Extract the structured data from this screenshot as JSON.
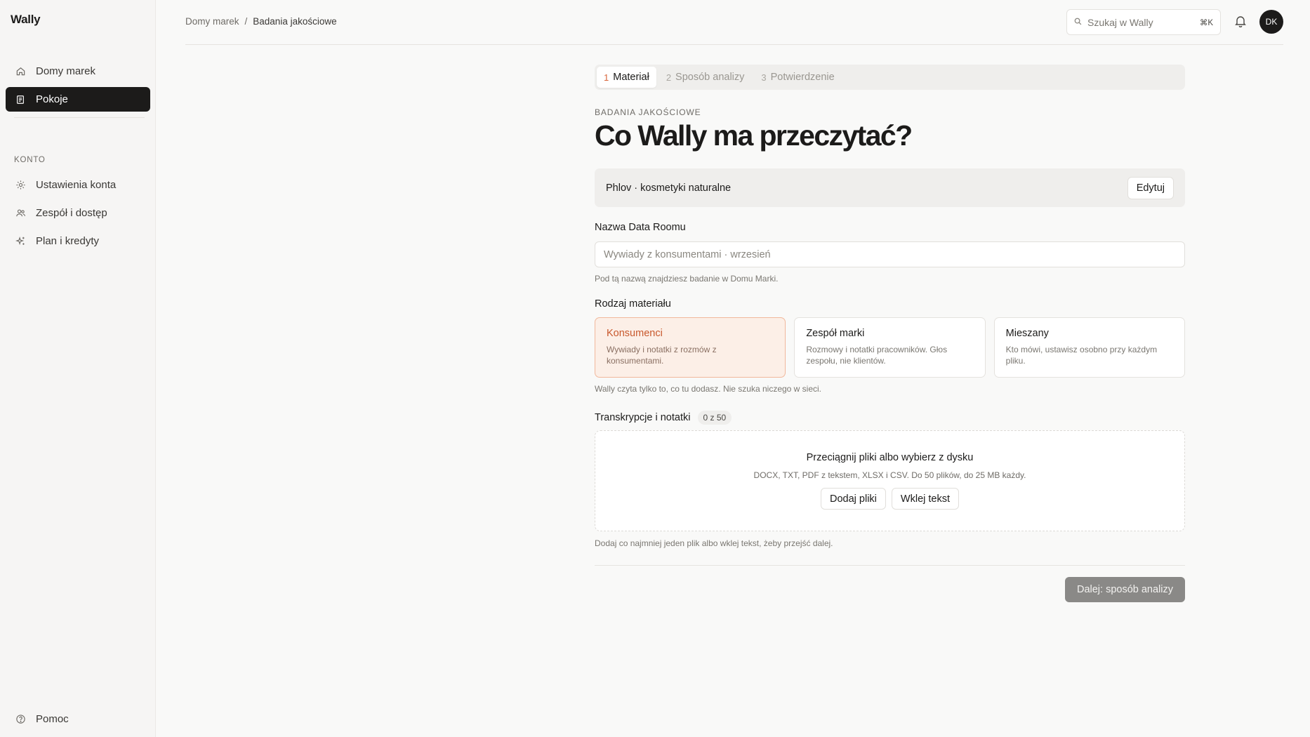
{
  "app": {
    "name": "Wally"
  },
  "sidebar": {
    "items": [
      {
        "label": "Domy marek",
        "icon": "home-icon"
      },
      {
        "label": "Pokoje",
        "icon": "document-icon",
        "active": true
      }
    ],
    "section_label": "KONTO",
    "account_items": [
      {
        "label": "Ustawienia konta",
        "icon": "gear-icon"
      },
      {
        "label": "Zespół i dostęp",
        "icon": "users-icon"
      },
      {
        "label": "Plan i kredyty",
        "icon": "sparkle-icon"
      }
    ],
    "help_label": "Pomoc"
  },
  "header": {
    "breadcrumb": [
      "Domy marek",
      "Badania jakościowe"
    ],
    "breadcrumb_separator": "/",
    "search_placeholder": "Szukaj w Wally",
    "search_shortcut": "⌘K",
    "avatar_initials": "DK"
  },
  "wizard": {
    "steps": [
      {
        "num": "1",
        "label": "Materiał",
        "active": true
      },
      {
        "num": "2",
        "label": "Sposób analizy"
      },
      {
        "num": "3",
        "label": "Potwierdzenie"
      }
    ],
    "eyebrow": "BADANIA JAKOŚCIOWE",
    "title": "Co Wally ma przeczytać?",
    "brand_name": "Phlov · kosmetyki naturalne",
    "edit_label": "Edytuj",
    "name_field": {
      "label": "Nazwa Data Roomu",
      "placeholder": "Wywiady z konsumentami · wrzesień",
      "help": "Pod tą nazwą znajdziesz badanie w Domu Marki."
    },
    "material": {
      "label": "Rodzaj materiału",
      "options": [
        {
          "title": "Konsumenci",
          "desc": "Wywiady i notatki z rozmów z konsumentami.",
          "selected": true
        },
        {
          "title": "Zespół marki",
          "desc": "Rozmowy i notatki pracowników. Głos zespołu, nie klientów."
        },
        {
          "title": "Mieszany",
          "desc": "Kto mówi, ustawisz osobno przy każdym pliku."
        }
      ],
      "help": "Wally czyta tylko to, co tu dodasz. Nie szuka niczego w sieci."
    },
    "files": {
      "label": "Transkrypcje i notatki",
      "count": "0 z 50",
      "drop_title": "Przeciągnij pliki albo wybierz z dysku",
      "drop_sub": "DOCX, TXT, PDF z tekstem, XLSX i CSV. Do 50 plików, do 25 MB każdy.",
      "add_files_label": "Dodaj pliki",
      "paste_label": "Wklej tekst",
      "help": "Dodaj co najmniej jeden plik albo wklej tekst, żeby przejść dalej."
    },
    "next_label": "Dalej: sposób analizy"
  },
  "colors": {
    "accent": "#d9653a",
    "selected_bg": "#fcefe7",
    "dark": "#1c1b1a"
  }
}
